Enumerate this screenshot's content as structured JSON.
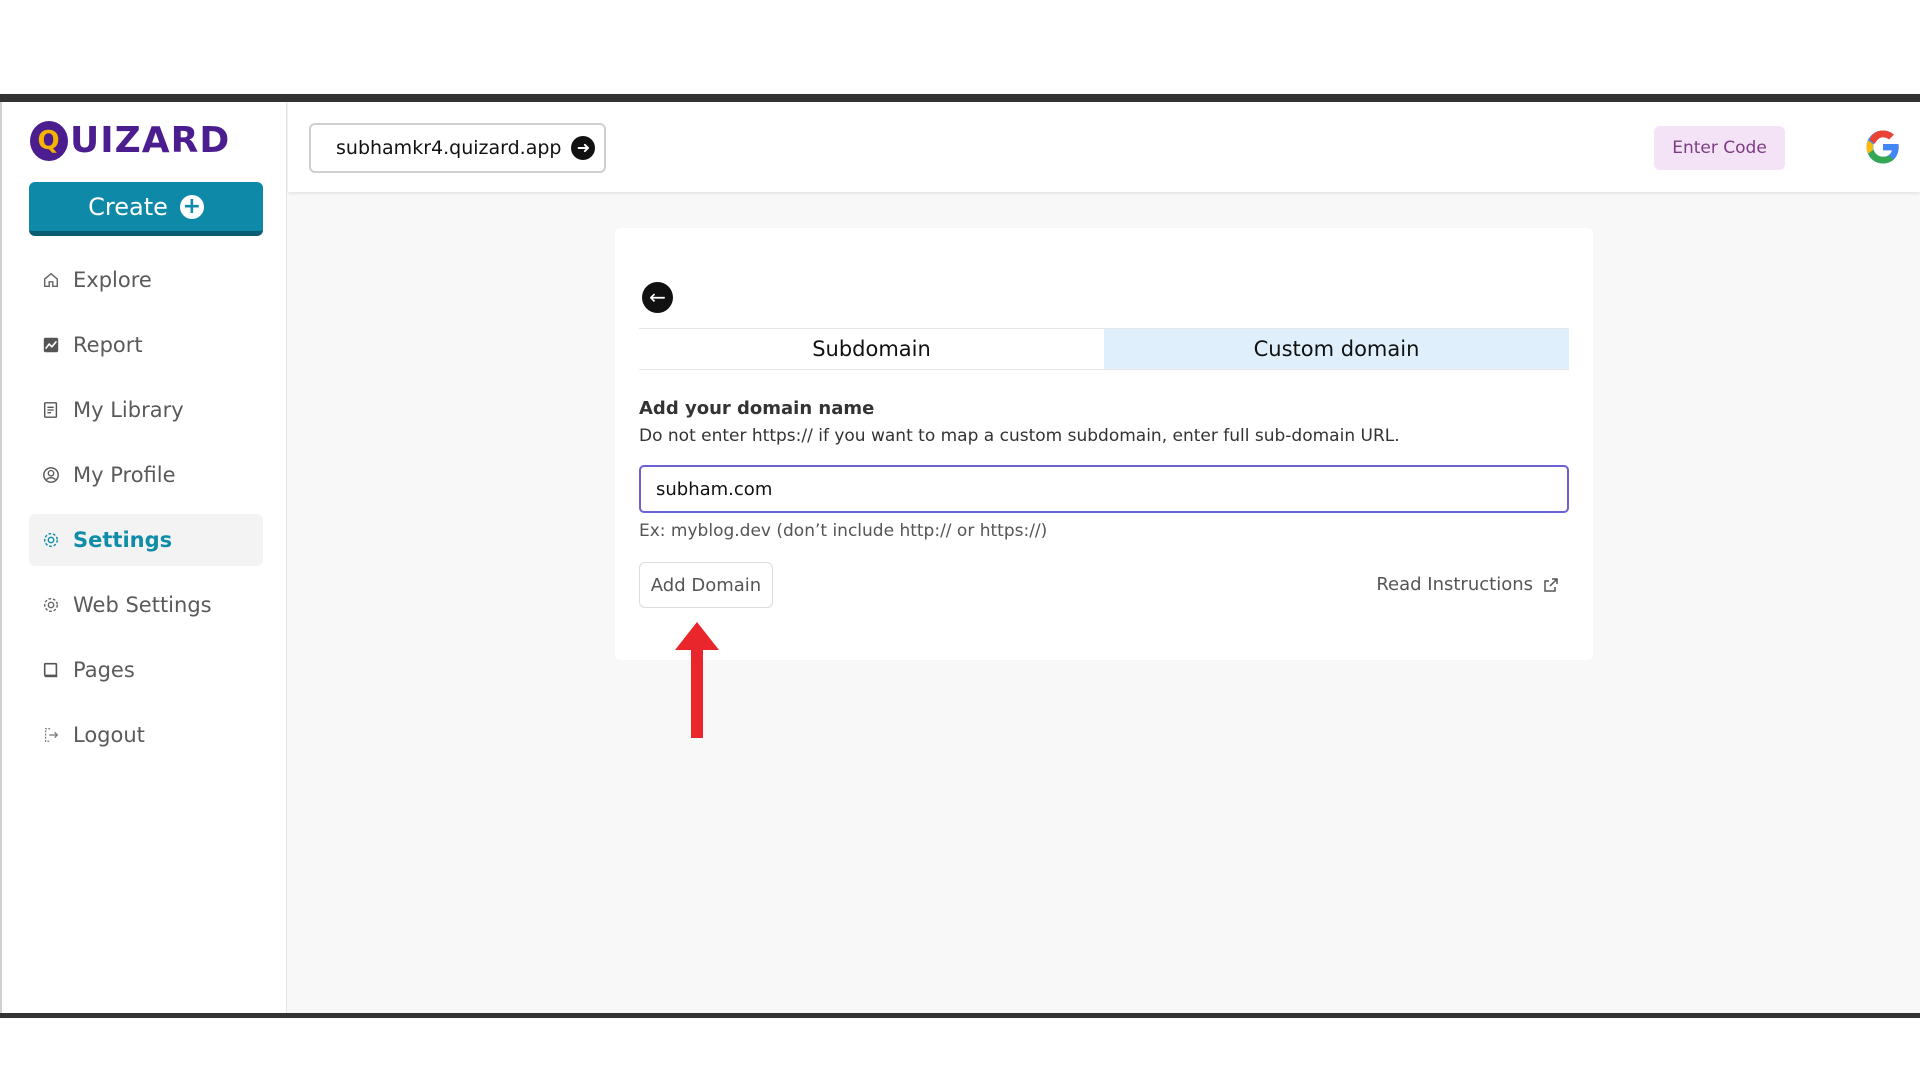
{
  "brand": {
    "logo_text": "UIZARD",
    "logo_letter": "Q"
  },
  "sidebar": {
    "create_label": "Create",
    "items": [
      {
        "label": "Explore",
        "icon": "home-icon"
      },
      {
        "label": "Report",
        "icon": "chart-icon"
      },
      {
        "label": "My Library",
        "icon": "library-icon"
      },
      {
        "label": "My Profile",
        "icon": "user-circle-icon"
      },
      {
        "label": "Settings",
        "icon": "gear-icon",
        "active": true
      },
      {
        "label": "Web Settings",
        "icon": "gear-icon"
      },
      {
        "label": "Pages",
        "icon": "pages-icon"
      },
      {
        "label": "Logout",
        "icon": "logout-icon"
      }
    ]
  },
  "header": {
    "domain": "subhamkr4.quizard.app",
    "enter_code": "Enter Code"
  },
  "card": {
    "tabs": [
      {
        "label": "Subdomain",
        "selected": false
      },
      {
        "label": "Custom domain",
        "selected": true
      }
    ],
    "title": "Add your domain name",
    "description": "Do not enter https:// if you want to map a custom subdomain, enter full sub-domain URL.",
    "input_value": "subham.com",
    "hint": "Ex: myblog.dev (don’t include http:// or https://)",
    "add_button": "Add Domain",
    "read_instructions": "Read Instructions"
  },
  "colors": {
    "brand_purple": "#4b1d8f",
    "primary": "#0f89a8",
    "tab_selected_bg": "#dff0fc",
    "input_border": "#6b62d8",
    "enter_code_bg": "#f4e2f6",
    "annotation_red": "#e8262b"
  }
}
